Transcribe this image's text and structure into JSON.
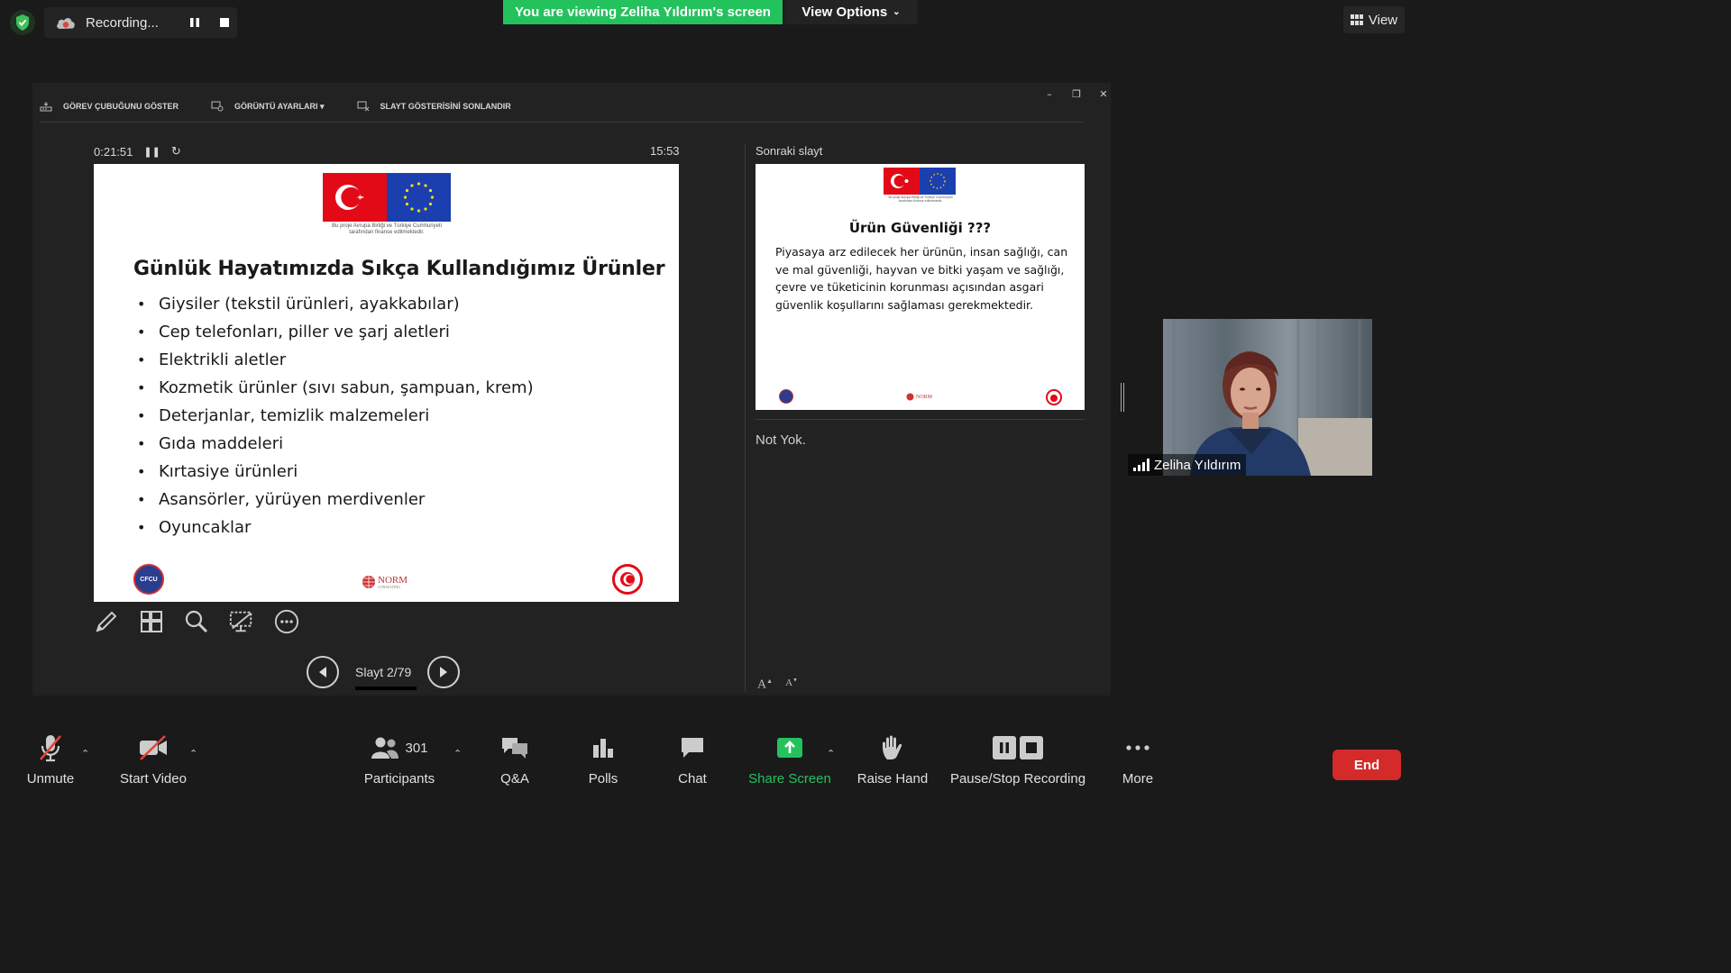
{
  "top": {
    "recording_label": "Recording...",
    "viewing_banner": "You are viewing Zeliha Yıldırım's screen",
    "view_options": "View Options",
    "view_label": "View"
  },
  "ppt_toolbar": {
    "show_taskbar": "GÖREV ÇUBUĞUNU GÖSTER",
    "display_settings": "GÖRÜNTÜ AYARLARI ▾",
    "end_slideshow": "SLAYT GÖSTERİSİNİ SONLANDIR"
  },
  "presenter": {
    "timer": "0:21:51",
    "clock": "15:53",
    "next_label": "Sonraki slayt",
    "notes": "Not Yok.",
    "slide_counter": "Slayt 2/79",
    "font_increase": "A",
    "font_decrease": "A"
  },
  "current_slide": {
    "flag_note": "Bu proje Avrupa Birliği ve Türkiye Cumhuriyeti tarafından finanse edilmektedir.",
    "title": "Günlük Hayatımızda Sıkça Kullandığımız Ürünler",
    "bullets": [
      "Giysiler (tekstil ürünleri, ayakkabılar)",
      "Cep telefonları, piller ve şarj aletleri",
      "Elektrikli aletler",
      "Kozmetik ürünler (sıvı sabun, şampuan, krem)",
      "Deterjanlar, temizlik malzemeleri",
      "Gıda maddeleri",
      "Kırtasiye ürünleri",
      "Asansörler, yürüyen merdivenler",
      "Oyuncaklar"
    ],
    "logo_left": "CFCU",
    "logo_mid": "NORM",
    "logo_mid_sub": "CONSULTING"
  },
  "next_slide": {
    "title": "Ürün Güvenliği ???",
    "body": "Piyasaya arz edilecek her ürünün, insan sağlığı, can ve mal güvenliği, hayvan ve bitki yaşam ve sağlığı, çevre ve tüketicinin korunması açısından asgari güvenlik koşullarını sağlaması gerekmektedir."
  },
  "participant": {
    "name": "Zeliha Yıldırım"
  },
  "toolbar": {
    "unmute": "Unmute",
    "start_video": "Start Video",
    "participants": "Participants",
    "participant_count": "301",
    "qa": "Q&A",
    "polls": "Polls",
    "chat": "Chat",
    "share_screen": "Share Screen",
    "raise_hand": "Raise Hand",
    "pause_stop_recording": "Pause/Stop Recording",
    "more": "More",
    "end": "End"
  },
  "colors": {
    "share_green": "#24c25d",
    "end_red": "#d42a2a",
    "muted_red": "#e0433c"
  }
}
